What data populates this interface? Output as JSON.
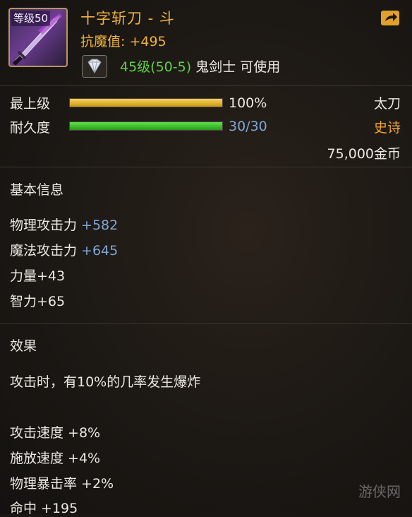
{
  "item": {
    "level_badge": "等级50",
    "name": "十字斩刀 - 斗",
    "resist": "抗魔值: +495",
    "requirement_level": "45级(50-5)",
    "requirement_class": " 鬼剑士 可使用"
  },
  "status": {
    "mastery_label": "最上级",
    "mastery_percent": 100,
    "mastery_value": "100%",
    "durability_label": "耐久度",
    "durability_current": 30,
    "durability_max": 30,
    "durability_value": "30/30",
    "weapon_type": "太刀",
    "rarity": "史诗",
    "price": "75,000金币"
  },
  "colors": {
    "title_gold": "#f0b33b",
    "rarity_orange": "#f0a030",
    "value_blue": "#7fa6d6",
    "req_green": "#5fd04a"
  },
  "basic_info": {
    "title": "基本信息",
    "stats": [
      {
        "label": "物理攻击力 ",
        "value": "+582"
      },
      {
        "label": "魔法攻击力 ",
        "value": "+645"
      },
      {
        "label": "力量+43",
        "value": ""
      },
      {
        "label": "智力+65",
        "value": ""
      }
    ]
  },
  "effect": {
    "title": "效果",
    "description": "攻击时，有10%的几率发生爆炸",
    "bonuses": [
      "攻击速度 +8%",
      "施放速度 +4%",
      "物理暴击率 +2%",
      "命中 +195"
    ]
  },
  "watermark": "游侠网",
  "icons": {
    "share": "share-out-icon",
    "gem": "diamond-icon",
    "weapon": "katana-icon"
  }
}
